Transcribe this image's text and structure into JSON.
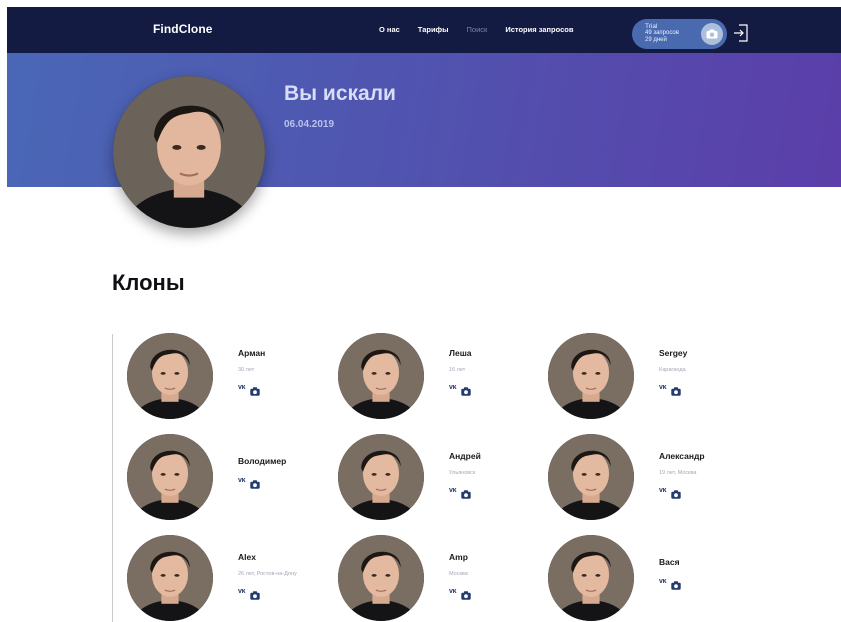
{
  "header": {
    "logo": "FindClone",
    "nav": [
      {
        "label": "О нас",
        "muted": false
      },
      {
        "label": "Тарифы",
        "muted": false
      },
      {
        "label": "Поиск",
        "muted": true
      },
      {
        "label": "История запросов",
        "muted": false
      }
    ],
    "trial": {
      "plan": "Trial",
      "requests": "49 запросов",
      "days": "29 дней"
    }
  },
  "hero": {
    "title": "Вы искали",
    "date": "06.04.2019"
  },
  "clones": {
    "title": "Клоны",
    "items": [
      {
        "name": "Арман",
        "meta": "30 лет"
      },
      {
        "name": "Леша",
        "meta": "16 лет"
      },
      {
        "name": "Sergey",
        "meta": "Караганда"
      },
      {
        "name": "Володимер",
        "meta": ""
      },
      {
        "name": "Андрей",
        "meta": "Ульяновск"
      },
      {
        "name": "Александр",
        "meta": "19 лет, Москва"
      },
      {
        "name": "Alex",
        "meta": "26 лет, Ростов-на-Дону"
      },
      {
        "name": "Amp",
        "meta": "Москва"
      },
      {
        "name": "Вася",
        "meta": ""
      }
    ],
    "social_label": "vk"
  },
  "colors": {
    "nav_bg": "#131b42",
    "hero_start": "#4a67b6",
    "hero_end": "#5b3ea9",
    "icon_blue": "#233b6e"
  }
}
